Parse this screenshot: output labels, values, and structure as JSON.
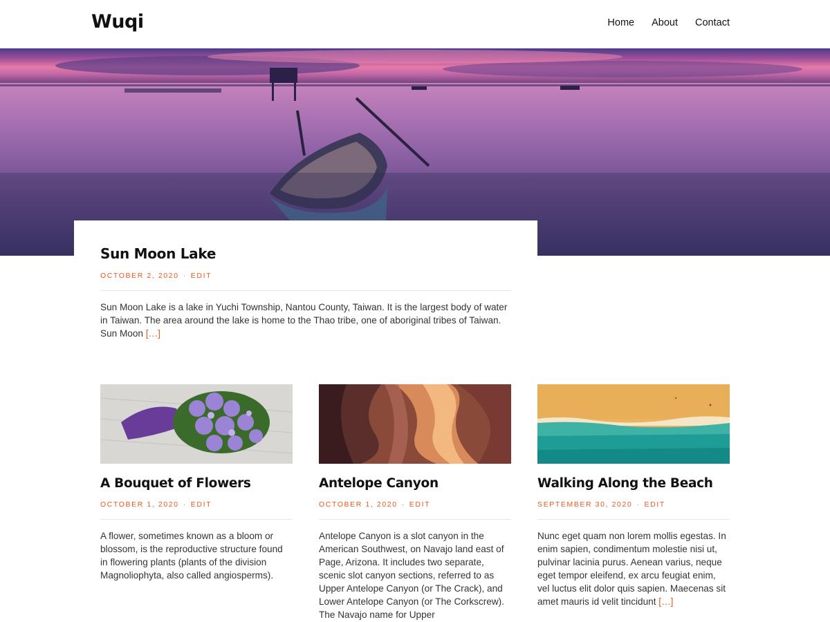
{
  "site": {
    "title": "Wuqi"
  },
  "nav": {
    "items": [
      "Home",
      "About",
      "Contact"
    ]
  },
  "featured": {
    "title": "Sun Moon Lake",
    "date": "October 2, 2020",
    "edit": "Edit",
    "excerpt": "Sun Moon Lake is a lake in Yuchi Township, Nantou County, Taiwan. It is the largest body of water in Taiwan. The area around the lake is home to the Thao tribe, one of aboriginal tribes of Taiwan. Sun Moon",
    "more": "[…]"
  },
  "posts": [
    {
      "title": "A Bouquet of Flowers",
      "date": "October 1, 2020",
      "edit": "Edit",
      "excerpt": "A flower, sometimes known as a bloom or blossom, is the reproductive structure found in flowering plants (plants of the division Magnoliophyta, also called angiosperms).",
      "more": ""
    },
    {
      "title": "Antelope Canyon",
      "date": "October 1, 2020",
      "edit": "Edit",
      "excerpt": "Antelope Canyon is a slot canyon in the American Southwest, on Navajo land east of Page, Arizona. It includes two separate, scenic slot canyon sections, referred to as Upper Antelope Canyon (or The Crack), and Lower Antelope Canyon (or The Corkscrew). The Navajo name for Upper",
      "more": ""
    },
    {
      "title": "Walking Along the Beach",
      "date": "September 30, 2020",
      "edit": "Edit",
      "excerpt": "Nunc eget quam non lorem mollis egestas. In enim sapien, condimentum molestie nisi ut, pulvinar lacinia purus. Aenean varius, neque eget tempor eleifend, ex arcu feugiat enim, vel luctus elit dolor quis sapien. Maecenas sit amet mauris id velit tincidunt",
      "more": "[…]"
    }
  ],
  "colors": {
    "accent": "#e8591c",
    "text": "#333333",
    "title": "#111111"
  },
  "images": {
    "hero": "sunset-lake-boat-image",
    "post0": "purple-flower-bouquet-image",
    "post1": "antelope-canyon-image",
    "post2": "aerial-beach-image"
  }
}
